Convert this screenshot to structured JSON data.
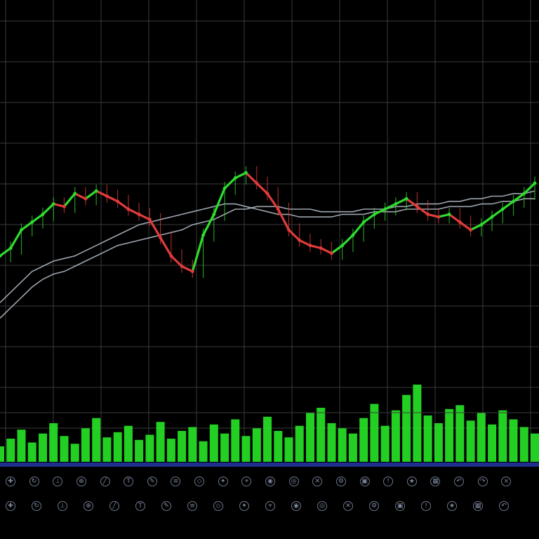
{
  "chart_data": {
    "type": "line",
    "title": "",
    "xlabel": "",
    "ylabel": "",
    "grid": true,
    "ylim": [
      0,
      100
    ],
    "x_count": 51,
    "series": [
      {
        "values": [
          42,
          45,
          52,
          55,
          58,
          62,
          61,
          66,
          64,
          67,
          65,
          63,
          60,
          58,
          56,
          49,
          42,
          38,
          36,
          50,
          58,
          68,
          72,
          74,
          70,
          66,
          60,
          52,
          48,
          46,
          45,
          43,
          46,
          50,
          55,
          58,
          60,
          62,
          64,
          61,
          58,
          57,
          58,
          55,
          52,
          54,
          57,
          60,
          63,
          66,
          70
        ]
      },
      {
        "values": [
          24,
          28,
          32,
          36,
          38,
          40,
          41,
          42,
          44,
          46,
          48,
          50,
          52,
          54,
          55,
          56,
          57,
          58,
          59,
          60,
          61,
          62,
          62,
          61,
          60,
          59,
          58,
          58,
          57,
          57,
          57,
          57,
          58,
          58,
          58,
          59,
          59,
          59,
          60,
          60,
          60,
          60,
          61,
          61,
          61,
          62,
          62,
          63,
          63,
          64,
          64
        ]
      },
      {
        "values": [
          18,
          22,
          26,
          30,
          33,
          35,
          36,
          38,
          40,
          42,
          44,
          46,
          47,
          48,
          49,
          50,
          51,
          52,
          54,
          55,
          56,
          58,
          60,
          60,
          61,
          61,
          61,
          60,
          60,
          60,
          59,
          59,
          59,
          59,
          60,
          60,
          60,
          61,
          61,
          62,
          62,
          62,
          63,
          63,
          64,
          64,
          65,
          65,
          66,
          66,
          67
        ]
      }
    ],
    "volume": {
      "values": [
        12,
        18,
        25,
        15,
        22,
        30,
        20,
        14,
        26,
        34,
        19,
        23,
        28,
        17,
        21,
        31,
        18,
        24,
        27,
        16,
        29,
        22,
        33,
        20,
        26,
        35,
        24,
        19,
        28,
        38,
        42,
        30,
        26,
        22,
        34,
        45,
        28,
        40,
        52,
        60,
        36,
        30,
        41,
        44,
        32,
        38,
        29,
        40,
        33,
        27,
        22
      ]
    },
    "colors": {
      "up": "#2fdc2f",
      "down": "#e23b3b",
      "background": "#000000",
      "grid": "#3a3a3a",
      "ma_line": "#b9c2cc",
      "volume": "#27e627",
      "divider": "#1f2f8f",
      "icon": "#7f8aa0"
    }
  },
  "toolbar": {
    "row1_icons": [
      "crosshair-icon",
      "refresh-icon",
      "ruler-icon",
      "zoom-icon",
      "trend-icon",
      "text-icon",
      "pen-icon",
      "fib-icon",
      "shape-icon",
      "brush-icon",
      "magnet-icon",
      "lock-icon",
      "eye-icon",
      "trash-icon",
      "settings-icon",
      "camera-icon",
      "alert-icon",
      "star-icon",
      "layout-icon",
      "undo-icon",
      "redo-icon",
      "close-icon"
    ],
    "row2_icons": [
      "cursor-icon",
      "grid-icon",
      "measure-icon",
      "hand-icon",
      "arrow-icon",
      "clock-icon",
      "note-icon",
      "tag-icon",
      "bar-icon",
      "circle-icon",
      "line-icon",
      "layers-icon",
      "flag-icon",
      "pin-icon",
      "target-icon",
      "filter-icon",
      "share-icon",
      "bell-icon",
      "fullscreen-icon",
      "gear-icon"
    ]
  }
}
